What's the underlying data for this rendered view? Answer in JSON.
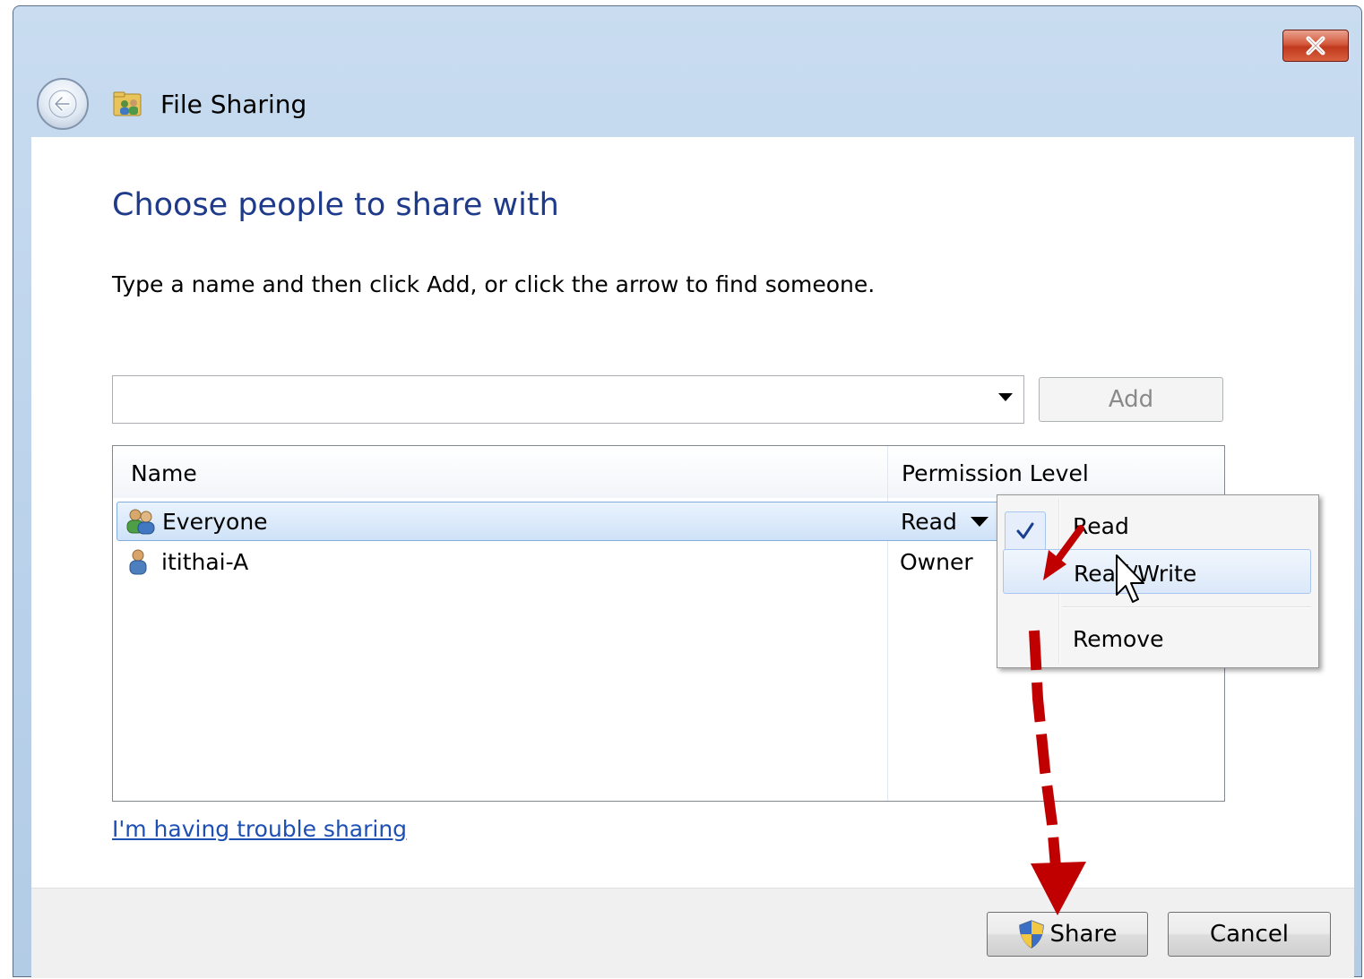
{
  "window": {
    "title": "File Sharing",
    "close_icon": "close-icon",
    "back_icon": "back-arrow-icon"
  },
  "main": {
    "heading": "Choose people to share with",
    "instruction": "Type a name and then click Add, or click the arrow to find someone.",
    "name_input": {
      "value": "",
      "placeholder": ""
    },
    "add_label": "Add",
    "list": {
      "columns": [
        "Name",
        "Permission Level"
      ],
      "rows": [
        {
          "name": "Everyone",
          "permission": "Read",
          "icon": "group-icon",
          "selected": true
        },
        {
          "name": "itithai-A",
          "permission": "Owner",
          "icon": "user-icon",
          "selected": false
        }
      ]
    },
    "trouble_link": "I'm having trouble sharing"
  },
  "permission_menu": {
    "items": [
      {
        "label": "Read",
        "checked": true
      },
      {
        "label": "Read/Write",
        "hovered": true
      },
      {
        "label": "Remove"
      }
    ]
  },
  "footer": {
    "share_label": "Share",
    "cancel_label": "Cancel",
    "share_icon": "uac-shield-icon"
  },
  "colors": {
    "heading": "#1e3a8a",
    "link": "#1e50b4",
    "annotation_arrow": "#c00000",
    "titlebar": "#b9d1ea"
  }
}
